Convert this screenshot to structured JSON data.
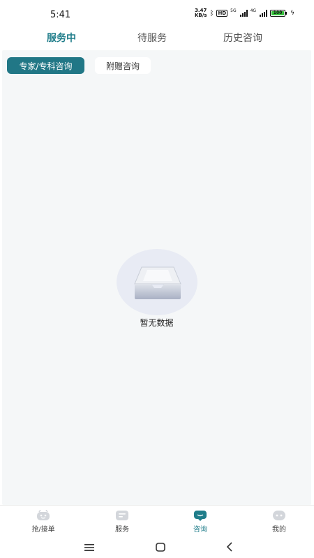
{
  "status_bar": {
    "time": "5:41",
    "speed_value": "3.47",
    "speed_unit": "KB/s",
    "hd": "HD",
    "net1": "5G",
    "net2": "4G",
    "battery": "100"
  },
  "tabs": [
    {
      "label": "服务中",
      "active": true
    },
    {
      "label": "待服务",
      "active": false
    },
    {
      "label": "历史咨询",
      "active": false
    }
  ],
  "filters": [
    {
      "label": "专家/专科咨询",
      "active": true
    },
    {
      "label": "附赠咨询",
      "active": false
    }
  ],
  "empty_state": {
    "text": "暂无数据",
    "icon": "empty-box-icon"
  },
  "bottom_nav": [
    {
      "label": "抢/接单",
      "icon": "grab-order-icon",
      "active": false
    },
    {
      "label": "服务",
      "icon": "service-icon",
      "active": false
    },
    {
      "label": "咨询",
      "icon": "consult-icon",
      "active": true
    },
    {
      "label": "我的",
      "icon": "profile-icon",
      "active": false
    }
  ],
  "colors": {
    "accent": "#1f7d8a",
    "chip_active": "#217786",
    "content_bg": "#f5f7f8",
    "nav_icon": "#d3d6db"
  }
}
